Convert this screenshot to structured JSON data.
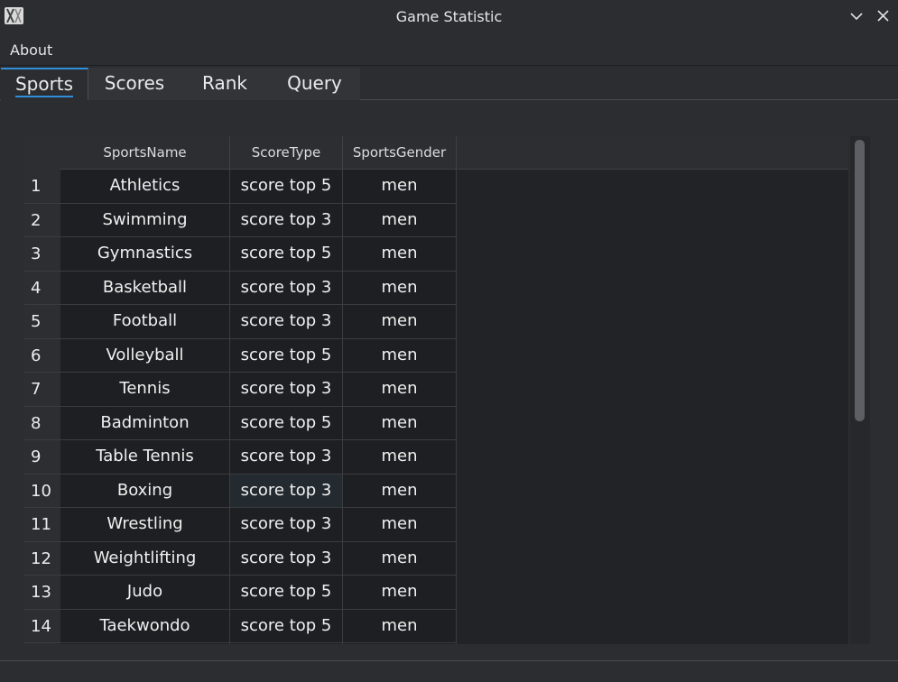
{
  "window": {
    "title": "Game Statistic"
  },
  "menu": {
    "items": [
      "About"
    ]
  },
  "tabs": [
    "Sports",
    "Scores",
    "Rank",
    "Query"
  ],
  "table": {
    "columns": [
      "SportsName",
      "ScoreType",
      "SportsGender"
    ],
    "rows": [
      {
        "num": "1",
        "name": "Athletics",
        "score_type": "score top 5",
        "gender": "men"
      },
      {
        "num": "2",
        "name": "Swimming",
        "score_type": "score top 3",
        "gender": "men"
      },
      {
        "num": "3",
        "name": "Gymnastics",
        "score_type": "score top 5",
        "gender": "men"
      },
      {
        "num": "4",
        "name": "Basketball",
        "score_type": "score top 3",
        "gender": "men"
      },
      {
        "num": "5",
        "name": "Football",
        "score_type": "score top 3",
        "gender": "men"
      },
      {
        "num": "6",
        "name": "Volleyball",
        "score_type": "score top 5",
        "gender": "men"
      },
      {
        "num": "7",
        "name": "Tennis",
        "score_type": "score top 3",
        "gender": "men"
      },
      {
        "num": "8",
        "name": "Badminton",
        "score_type": "score top 5",
        "gender": "men"
      },
      {
        "num": "9",
        "name": "Table Tennis",
        "score_type": "score top 3",
        "gender": "men"
      },
      {
        "num": "10",
        "name": "Boxing",
        "score_type": "score top 3",
        "gender": "men"
      },
      {
        "num": "11",
        "name": "Wrestling",
        "score_type": "score top 3",
        "gender": "men"
      },
      {
        "num": "12",
        "name": "Weightlifting",
        "score_type": "score top 3",
        "gender": "men"
      },
      {
        "num": "13",
        "name": "Judo",
        "score_type": "score top 5",
        "gender": "men"
      },
      {
        "num": "14",
        "name": "Taekwondo",
        "score_type": "score top 5",
        "gender": "men"
      },
      {
        "num": "",
        "name": "",
        "score_type": "",
        "gender": ""
      }
    ]
  },
  "colors": {
    "accent": "#2f8fd8",
    "background": "#2b2d30",
    "cell_background": "#1e1f22"
  },
  "icons": {
    "app": "app-logo-icon",
    "minimize": "chevron-down-icon",
    "close": "close-icon"
  }
}
